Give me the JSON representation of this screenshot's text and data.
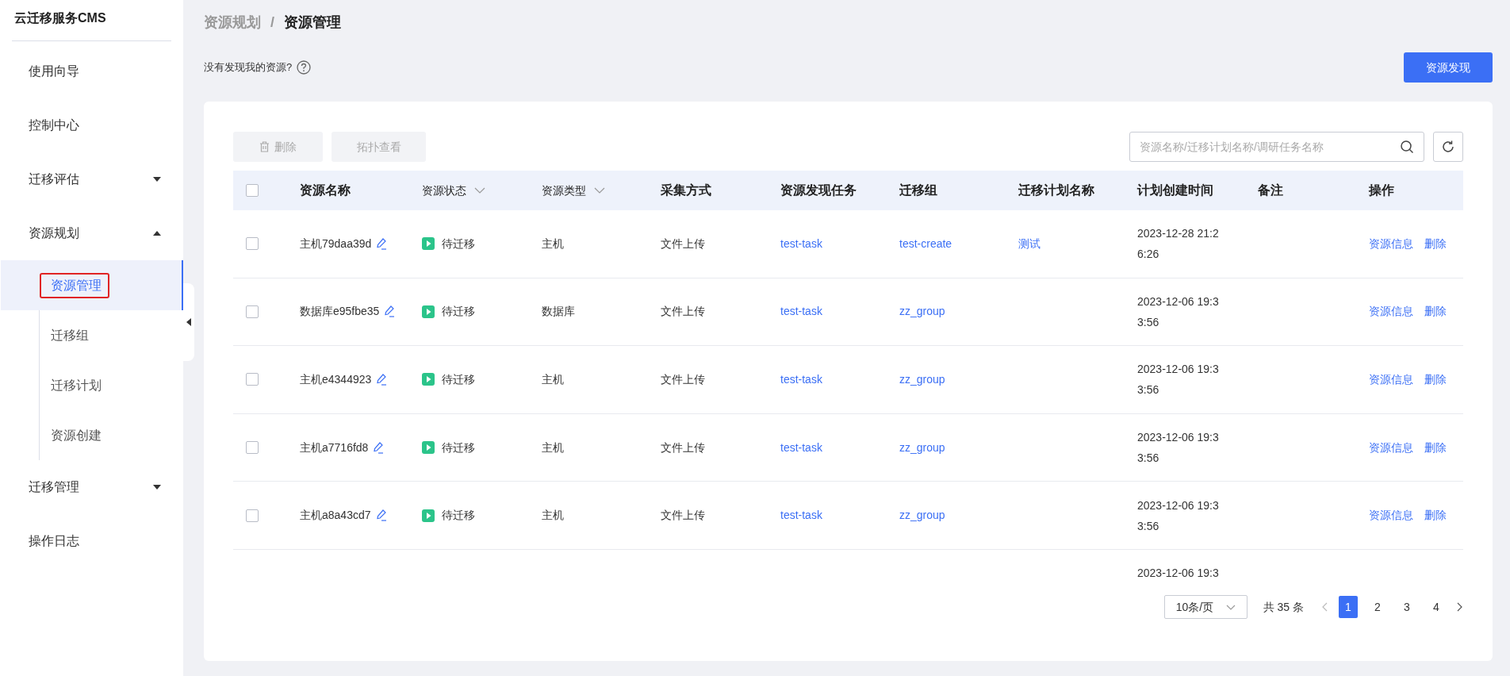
{
  "app_title": "云迁移服务CMS",
  "sidebar": {
    "items": [
      {
        "label": "使用向导",
        "kind": "link",
        "selected": false
      },
      {
        "label": "控制中心",
        "kind": "link",
        "selected": false
      },
      {
        "label": "迁移评估",
        "kind": "group",
        "expanded": false,
        "selected": false
      },
      {
        "label": "资源规划",
        "kind": "group",
        "expanded": true,
        "selected": false,
        "children": [
          {
            "label": "资源管理",
            "selected": true
          },
          {
            "label": "迁移组",
            "selected": false
          },
          {
            "label": "迁移计划",
            "selected": false
          },
          {
            "label": "资源创建",
            "selected": false
          }
        ]
      },
      {
        "label": "迁移管理",
        "kind": "group",
        "expanded": false,
        "selected": false
      },
      {
        "label": "操作日志",
        "kind": "link",
        "selected": false
      }
    ]
  },
  "breadcrumb": [
    "资源规划",
    "/",
    "资源管理"
  ],
  "hint": "没有发现我的资源?",
  "discover_button": "资源发现",
  "toolbar": {
    "delete_button": "删除",
    "topology_button": "拓扑查看",
    "search": {
      "placeholder": "资源名称/迁移计划名称/调研任务名称"
    }
  },
  "table": {
    "columns": [
      {
        "label": "资源名称",
        "filter": false,
        "bold": true
      },
      {
        "label": "资源状态",
        "filter": true,
        "bold": false
      },
      {
        "label": "资源类型",
        "filter": true,
        "bold": false
      },
      {
        "label": "采集方式",
        "filter": false,
        "bold": true
      },
      {
        "label": "资源发现任务",
        "filter": false,
        "bold": true
      },
      {
        "label": "迁移组",
        "filter": false,
        "bold": true
      },
      {
        "label": "迁移计划名称",
        "filter": false,
        "bold": true
      },
      {
        "label": "计划创建时间",
        "filter": false,
        "bold": true
      },
      {
        "label": "备注",
        "filter": false,
        "bold": true
      },
      {
        "label": "操作",
        "filter": false,
        "bold": true
      }
    ],
    "header_checked": false,
    "rows": [
      {
        "checked": false,
        "name": "主机79daa39d",
        "status": "待迁移",
        "type": "主机",
        "method": "文件上传",
        "task": "test-task",
        "group": "test-create",
        "plan": "测试",
        "time": [
          "2023-12-28 21:2",
          "6:26"
        ],
        "actions": [
          "资源信息",
          "删除"
        ]
      },
      {
        "checked": false,
        "name": "数据库e95fbe35",
        "status": "待迁移",
        "type": "数据库",
        "method": "文件上传",
        "task": "test-task",
        "group": "zz_group",
        "time": [
          "2023-12-06 19:3",
          "3:56"
        ],
        "actions": [
          "资源信息",
          "删除"
        ]
      },
      {
        "checked": false,
        "name": "主机e4344923",
        "status": "待迁移",
        "type": "主机",
        "method": "文件上传",
        "task": "test-task",
        "group": "zz_group",
        "time": [
          "2023-12-06 19:3",
          "3:56"
        ],
        "actions": [
          "资源信息",
          "删除"
        ]
      },
      {
        "checked": false,
        "name": "主机a7716fd8",
        "status": "待迁移",
        "type": "主机",
        "method": "文件上传",
        "task": "test-task",
        "group": "zz_group",
        "time": [
          "2023-12-06 19:3",
          "3:56"
        ],
        "actions": [
          "资源信息",
          "删除"
        ]
      },
      {
        "checked": false,
        "name": "主机a8a43cd7",
        "status": "待迁移",
        "type": "主机",
        "method": "文件上传",
        "task": "test-task",
        "group": "zz_group",
        "time": [
          "2023-12-06 19:3",
          "3:56"
        ],
        "actions": [
          "资源信息",
          "删除"
        ]
      },
      {
        "partial": true,
        "time": [
          "2023-12-06 19:3"
        ]
      }
    ]
  },
  "pagination": {
    "page_size": "10条/页",
    "total": "共 35 条",
    "pages": [
      {
        "label": "1",
        "selected": true
      },
      {
        "label": "2",
        "selected": false
      },
      {
        "label": "3",
        "selected": false
      },
      {
        "label": "4",
        "selected": false
      }
    ]
  }
}
